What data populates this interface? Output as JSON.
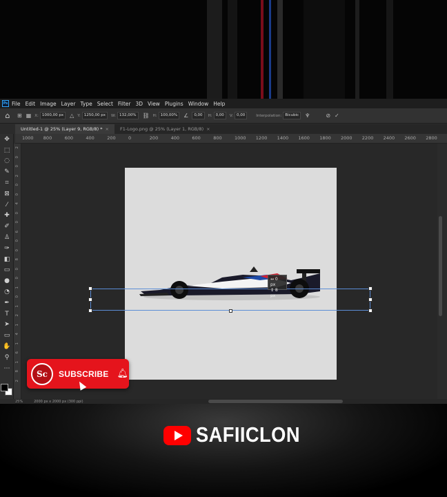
{
  "app": {
    "logo": "Ps"
  },
  "menu": [
    "File",
    "Edit",
    "Image",
    "Layer",
    "Type",
    "Select",
    "Filter",
    "3D",
    "View",
    "Plugins",
    "Window",
    "Help"
  ],
  "options": {
    "x_label": "X:",
    "x_value": "1000,00 px",
    "y_label": "Y:",
    "y_value": "1250,00 px",
    "w_label": "W:",
    "w_value": "132,00%",
    "h_label": "H:",
    "h_value": "100,00%",
    "angle_value": "0,00",
    "hskew_label": "H:",
    "hskew_value": "0,00",
    "vskew_label": "V:",
    "vskew_value": "0,00",
    "interp_label": "Interpolation:",
    "interp_value": "Bicubic"
  },
  "tabs": [
    {
      "label": "Untitled-1 @ 25% (Layer 9, RGB/8) *",
      "close": "×"
    },
    {
      "label": "F1-Logo.png @ 25% (Layer 1, RGB/8)",
      "close": "×"
    }
  ],
  "ruler_top": [
    "1000",
    "800",
    "600",
    "400",
    "200",
    "0",
    "200",
    "400",
    "600",
    "800",
    "1000",
    "1200",
    "1400",
    "1600",
    "1800",
    "2000",
    "2200",
    "2400",
    "2600",
    "2800"
  ],
  "ruler_left": [
    "2",
    "0",
    "0",
    "2",
    "0",
    "0",
    "4",
    "0",
    "0",
    "6",
    "0",
    "0",
    "8",
    "0",
    "0",
    "1",
    "0",
    "1",
    "2",
    "1",
    "4",
    "1",
    "6",
    "1",
    "8",
    "2"
  ],
  "transform_tooltip": {
    "line1": "↔ 0 px",
    "line2": "↕ 8 px"
  },
  "status": {
    "zoom": "25%",
    "doc_size": "2000 px x 2000 px (300 ppi)"
  },
  "subscribe": {
    "logo_text": "Sc",
    "label": "SUBSCRIBE"
  },
  "channel": {
    "name": "SAFIICLON"
  },
  "colors": {
    "accent": "#e5141c",
    "youtube": "#ff0000",
    "transform": "#5b8dd6"
  }
}
